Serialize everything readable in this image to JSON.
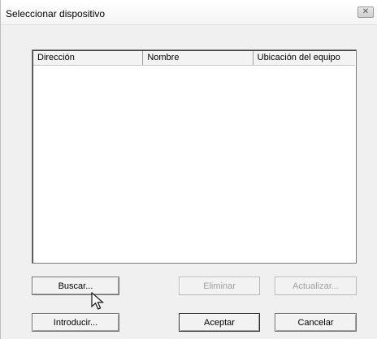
{
  "window": {
    "title": "Seleccionar dispositivo",
    "close_symbol": "✕"
  },
  "device_list": {
    "columns": [
      "Dirección",
      "Nombre",
      "Ubicación del equipo"
    ],
    "rows": []
  },
  "buttons": {
    "search": "Buscar...",
    "delete": "Eliminar",
    "update": "Actualizar...",
    "enter": "Introducir...",
    "accept": "Aceptar",
    "cancel": "Cancelar"
  },
  "icons": {
    "close": "close-icon",
    "cursor": "arrow-cursor-icon"
  }
}
